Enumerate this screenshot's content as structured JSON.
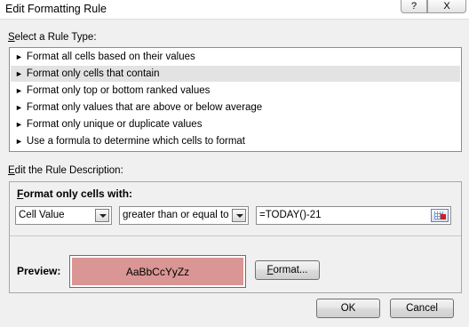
{
  "window": {
    "title": "Edit Formatting Rule",
    "help_label": "?",
    "close_label": "X"
  },
  "rule_type": {
    "label_hotkey": "S",
    "label_rest": "elect a Rule Type:",
    "items": [
      {
        "label": "Format all cells based on their values",
        "selected": false
      },
      {
        "label": "Format only cells that contain",
        "selected": true
      },
      {
        "label": "Format only top or bottom ranked values",
        "selected": false
      },
      {
        "label": "Format only values that are above or below average",
        "selected": false
      },
      {
        "label": "Format only unique or duplicate values",
        "selected": false
      },
      {
        "label": "Use a formula to determine which cells to format",
        "selected": false
      }
    ],
    "arrow_glyph": "►"
  },
  "description": {
    "label_hotkey": "E",
    "label_rest": "dit the Rule Description:",
    "format_only_hotkey": "F",
    "format_only_rest": "ormat only cells with:",
    "cell_combo_value": "Cell Value",
    "operator_combo_value": "greater than or equal to",
    "formula_value": "=TODAY()-21",
    "preview_label": "Preview:",
    "preview_text": "AaBbCcYyZz",
    "preview_fill_color": "#d99694",
    "format_button_hotkey": "F",
    "format_button_rest": "ormat..."
  },
  "footer": {
    "ok_label": "OK",
    "cancel_label": "Cancel"
  }
}
